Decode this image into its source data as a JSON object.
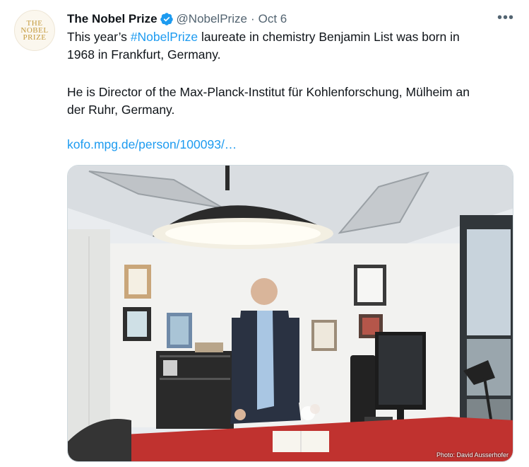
{
  "author": {
    "name": "The Nobel Prize",
    "handle": "@NobelPrize",
    "separator": "·",
    "date": "Oct 6",
    "avatar_lines": [
      "THE",
      "NOBEL",
      "PRIZE"
    ]
  },
  "tweet": {
    "line1_prefix": "This year’s ",
    "hashtag": "#NobelPrize",
    "line1_suffix": " laureate in chemistry Benjamin List was born in",
    "line2": "1968 in Frankfurt, Germany.",
    "para2_line1": "He is Director of the Max-Planck-Institut für Kohlenforschung, Mülheim an",
    "para2_line2": "der Ruhr, Germany.",
    "link_text": "kofo.mpg.de/person/100093/…"
  },
  "menu": {
    "more_label": "•••"
  },
  "media": {
    "photo_credit": "Photo: David Ausserhofer",
    "subject": "Man in dark blazer standing behind a red desk in an office under a large black pendant lamp"
  },
  "colors": {
    "link": "#1d9bf0",
    "verified": "#1d9bf0",
    "secondary_text": "#536471",
    "desk": "#c0322f",
    "lamp": "#2b2b2b"
  }
}
